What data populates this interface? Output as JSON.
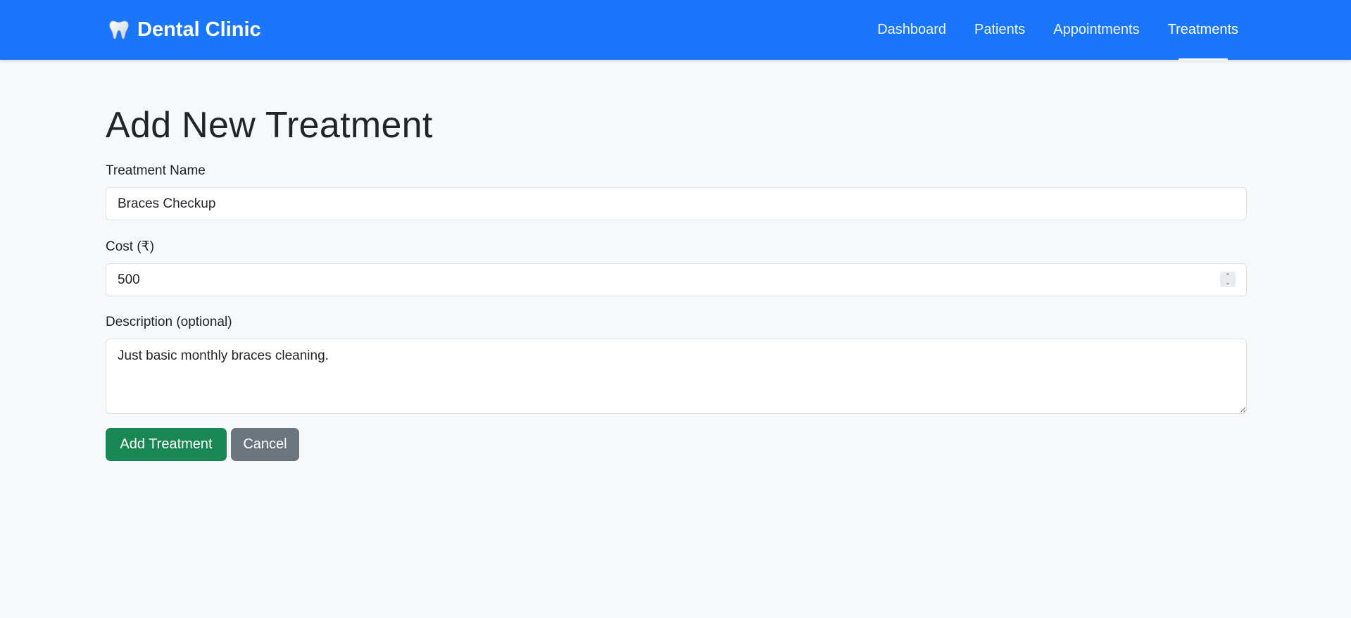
{
  "navbar": {
    "brand_icon": "tooth-icon",
    "brand_label": "Dental Clinic",
    "color": "#1a76fc",
    "links": [
      {
        "label": "Dashboard",
        "active": false
      },
      {
        "label": "Patients",
        "active": false
      },
      {
        "label": "Appointments",
        "active": false
      },
      {
        "label": "Treatments",
        "active": true
      }
    ]
  },
  "form": {
    "title": "Add New Treatment",
    "name_label": "Treatment Name",
    "name_value": "Braces Checkup",
    "cost_label": "Cost (₹)",
    "cost_value": "500",
    "description_label": "Description (optional)",
    "description_value": "Just basic monthly braces cleaning.",
    "submit_label": "Add Treatment",
    "cancel_label": "Cancel",
    "submit_color": "#198754",
    "cancel_color": "#6c757d"
  }
}
